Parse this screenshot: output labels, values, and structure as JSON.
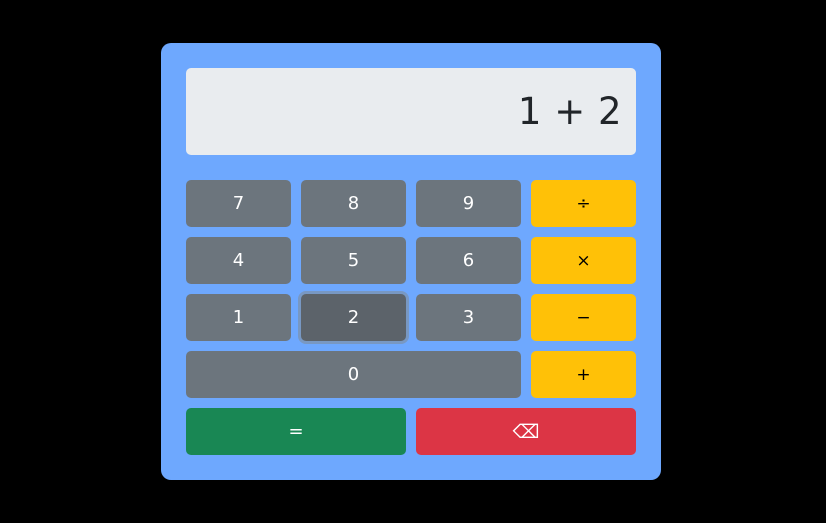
{
  "display": {
    "value": "1 + 2"
  },
  "keys": {
    "seven": "7",
    "eight": "8",
    "nine": "9",
    "divide": "÷",
    "four": "4",
    "five": "5",
    "six": "6",
    "multiply": "×",
    "one": "1",
    "two": "2",
    "three": "3",
    "subtract": "−",
    "zero": "0",
    "add": "+",
    "equals": "=",
    "backspace": "⌫"
  },
  "colors": {
    "background": "#000000",
    "panel": "#6ea8fe",
    "display": "#e9ecef",
    "number_key": "#6c757d",
    "operator_key": "#ffc107",
    "equals_key": "#198754",
    "backspace_key": "#dc3545"
  },
  "icons": {
    "backspace": "backspace-icon"
  }
}
